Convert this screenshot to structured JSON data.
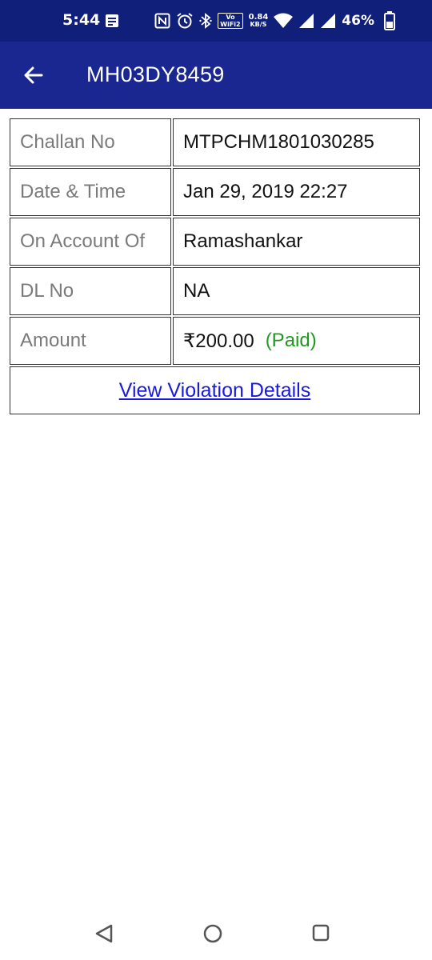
{
  "status_bar": {
    "time": "5:44",
    "net_speed_value": "0.84",
    "net_speed_unit": "KB/S",
    "volte_top": "Vo",
    "volte_bottom": "WiFi2",
    "battery_percent": "46%",
    "icons": [
      "notification-icon",
      "nfc-icon",
      "alarm-icon",
      "bluetooth-icon",
      "volte-wifi-icon",
      "wifi-icon",
      "signal-icon",
      "signal-icon",
      "battery-icon"
    ]
  },
  "app_bar": {
    "title": "MH03DY8459",
    "back_icon": "arrow-left-icon"
  },
  "challan": {
    "rows": [
      {
        "label": "Challan No",
        "value": "MTPCHM1801030285"
      },
      {
        "label": "Date & Time",
        "value": "Jan 29, 2019 22:27"
      },
      {
        "label": "On Account Of",
        "value": "Ramashankar"
      },
      {
        "label": "DL No",
        "value": "NA"
      },
      {
        "label": "Amount",
        "value": "₹200.00",
        "status": "(Paid)"
      }
    ],
    "link_label": "View Violation Details"
  },
  "colors": {
    "status_bar_bg": "#101f7a",
    "app_bar_bg": "#1a2790",
    "paid_green": "#1f9a1f",
    "link_blue": "#1a1adf"
  },
  "nav_bar": {
    "icons": [
      "nav-back-icon",
      "nav-home-icon",
      "nav-recents-icon"
    ]
  }
}
